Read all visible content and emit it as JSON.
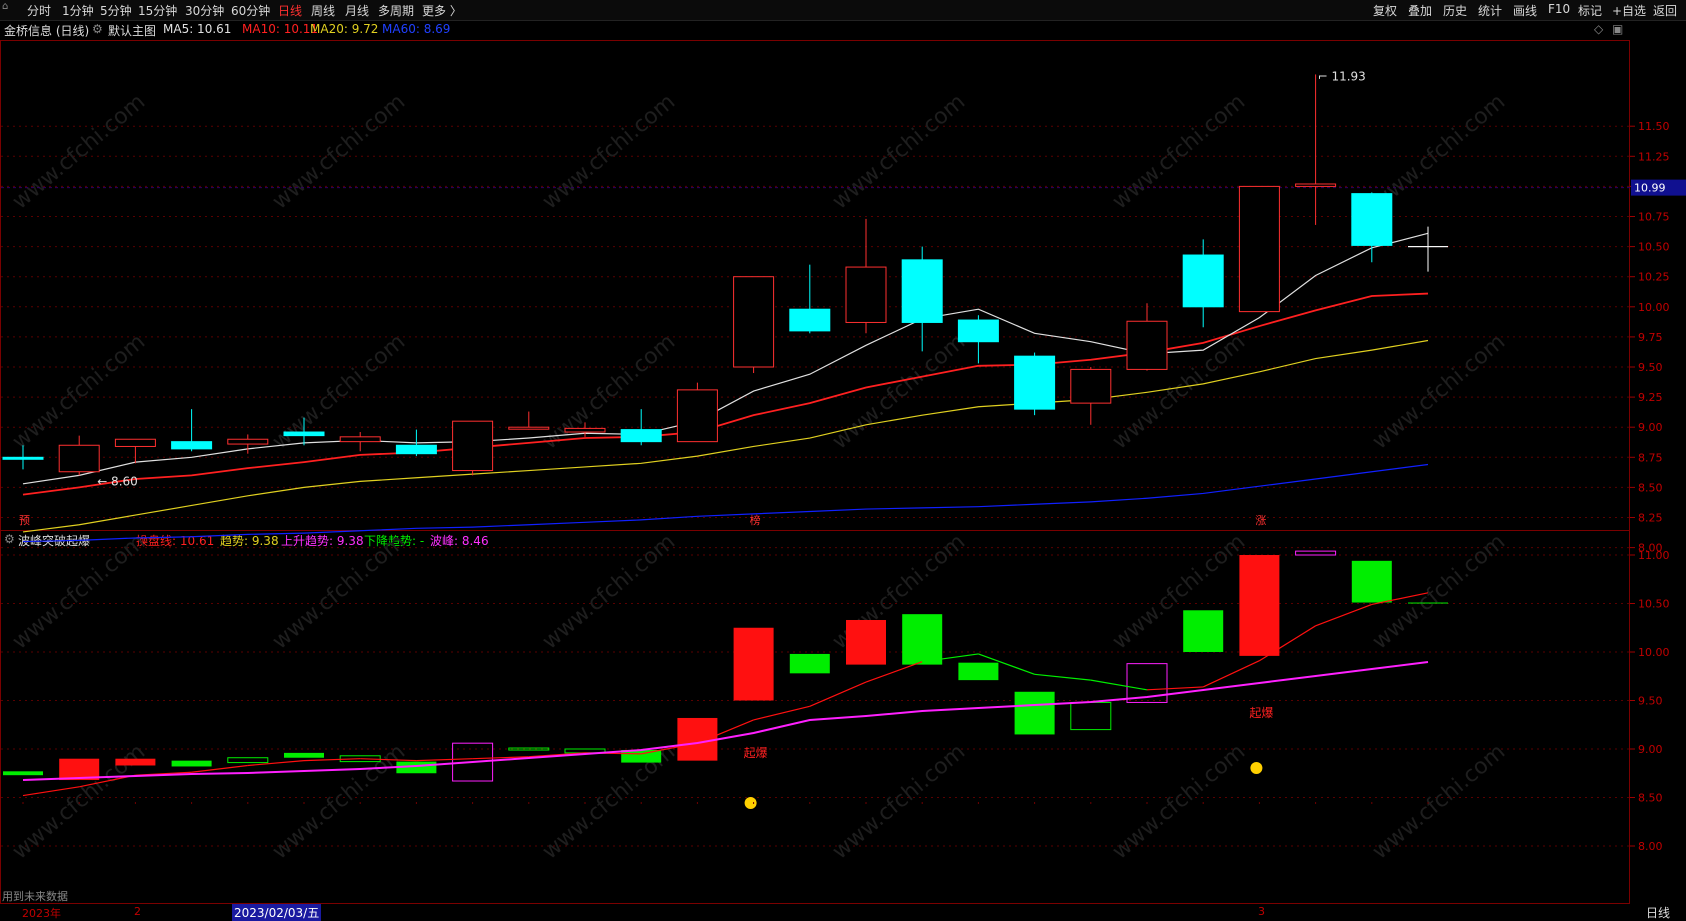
{
  "toolbar": {
    "periods": [
      "分时",
      "1分钟",
      "5分钟",
      "15分钟",
      "30分钟",
      "60分钟",
      "日线",
      "周线",
      "月线",
      "多周期",
      "更多 〉"
    ],
    "active_period": "日线",
    "right_buttons": [
      "复权",
      "叠加",
      "历史",
      "统计",
      "画线",
      "F10",
      "标记",
      "+自选",
      "返回"
    ]
  },
  "main_header": {
    "stock": "金桥信息 (日线)",
    "main_chart": "默认主图",
    "ma5": "MA5: 10.61",
    "ma10": "MA10: 10.11",
    "ma20": "MA20: 9.72",
    "ma60": "MA60: 8.69"
  },
  "sub_header": {
    "indicator": "波峰突破起爆",
    "cpx": "操盘线: 10.61",
    "trend": "趋势: 9.38",
    "up": "上升趋势: 9.38",
    "down": "下降趋势: -",
    "peak": "波峰: 8.46"
  },
  "main_axis": [
    "11.50",
    "11.25",
    "11.00",
    "10.75",
    "10.50",
    "10.25",
    "10.00",
    "9.75",
    "9.50",
    "9.25",
    "9.00",
    "8.75",
    "8.50",
    "8.25",
    "8.00"
  ],
  "current_price": "10.99",
  "high_label": "11.93",
  "low_label": "8.60",
  "sub_axis": [
    "11.00",
    "10.50",
    "10.00",
    "9.50",
    "9.00",
    "8.50",
    "8.00"
  ],
  "markers": {
    "yu": "预",
    "bang": "榜",
    "zhang": "涨",
    "qibao": "起爆"
  },
  "footer": {
    "future_data": "用到未来数据",
    "year": "2023年",
    "month2": "2",
    "date": "2023/02/03/五",
    "month3": "3",
    "period": "日线"
  },
  "watermark": "www.cfchi.com",
  "colors": {
    "up": "#ff3030",
    "down": "#00ffff",
    "ma5": "#e0e0e0",
    "ma10": "#ff2020",
    "ma20": "#e0d020",
    "ma60": "#1020ff",
    "sub_red": "#ff1010",
    "sub_green": "#00ee00",
    "sub_purple": "#ff20ff"
  },
  "chart_data": {
    "type": "candlestick",
    "candles": [
      {
        "o": 8.75,
        "h": 8.85,
        "l": 8.65,
        "c": 8.75,
        "dir": "down"
      },
      {
        "o": 8.63,
        "h": 8.93,
        "l": 8.6,
        "c": 8.85,
        "dir": "up"
      },
      {
        "o": 8.84,
        "h": 8.9,
        "l": 8.7,
        "c": 8.9,
        "dir": "up"
      },
      {
        "o": 8.88,
        "h": 9.15,
        "l": 8.8,
        "c": 8.82,
        "dir": "down"
      },
      {
        "o": 8.86,
        "h": 8.94,
        "l": 8.78,
        "c": 8.9,
        "dir": "up"
      },
      {
        "o": 8.96,
        "h": 9.08,
        "l": 8.85,
        "c": 8.93,
        "dir": "down"
      },
      {
        "o": 8.88,
        "h": 8.96,
        "l": 8.8,
        "c": 8.92,
        "dir": "up"
      },
      {
        "o": 8.85,
        "h": 8.98,
        "l": 8.76,
        "c": 8.78,
        "dir": "down"
      },
      {
        "o": 8.64,
        "h": 9.05,
        "l": 8.6,
        "c": 9.05,
        "dir": "up"
      },
      {
        "o": 9.0,
        "h": 9.13,
        "l": 8.98,
        "c": 9.0,
        "dir": "up"
      },
      {
        "o": 8.96,
        "h": 9.04,
        "l": 8.92,
        "c": 8.99,
        "dir": "up"
      },
      {
        "o": 8.98,
        "h": 9.15,
        "l": 8.85,
        "c": 8.88,
        "dir": "down"
      },
      {
        "o": 8.88,
        "h": 9.37,
        "l": 8.88,
        "c": 9.31,
        "dir": "up"
      },
      {
        "o": 9.5,
        "h": 10.25,
        "l": 9.45,
        "c": 10.25,
        "dir": "up"
      },
      {
        "o": 9.98,
        "h": 10.35,
        "l": 9.78,
        "c": 9.8,
        "dir": "down"
      },
      {
        "o": 9.87,
        "h": 10.73,
        "l": 9.78,
        "c": 10.33,
        "dir": "up"
      },
      {
        "o": 10.39,
        "h": 10.5,
        "l": 9.63,
        "c": 9.87,
        "dir": "down"
      },
      {
        "o": 9.89,
        "h": 9.93,
        "l": 9.53,
        "c": 9.71,
        "dir": "down"
      },
      {
        "o": 9.59,
        "h": 9.62,
        "l": 9.1,
        "c": 9.15,
        "dir": "down"
      },
      {
        "o": 9.2,
        "h": 9.5,
        "l": 9.02,
        "c": 9.48,
        "dir": "up"
      },
      {
        "o": 9.48,
        "h": 10.03,
        "l": 9.47,
        "c": 9.88,
        "dir": "up"
      },
      {
        "o": 10.43,
        "h": 10.56,
        "l": 9.83,
        "c": 10.0,
        "dir": "down"
      },
      {
        "o": 9.96,
        "h": 11.0,
        "l": 9.96,
        "c": 11.0,
        "dir": "up"
      },
      {
        "o": 11.0,
        "h": 11.93,
        "l": 10.68,
        "c": 11.02,
        "dir": "up"
      },
      {
        "o": 10.94,
        "h": 10.95,
        "l": 10.37,
        "c": 10.51,
        "dir": "down"
      },
      {
        "o": 10.5,
        "h": 10.66,
        "l": 10.3,
        "c": 10.5,
        "dir": "flat"
      }
    ],
    "ma5": [
      8.53,
      8.6,
      8.71,
      8.75,
      8.82,
      8.87,
      8.89,
      8.87,
      8.88,
      8.91,
      8.95,
      8.94,
      9.05,
      9.3,
      9.44,
      9.68,
      9.9,
      9.98,
      9.78,
      9.71,
      9.61,
      9.64,
      9.91,
      10.26,
      10.49,
      10.61
    ],
    "ma10": [
      8.44,
      8.5,
      8.57,
      8.6,
      8.66,
      8.71,
      8.77,
      8.79,
      8.83,
      8.87,
      8.91,
      8.92,
      8.96,
      9.1,
      9.2,
      9.33,
      9.42,
      9.51,
      9.52,
      9.56,
      9.62,
      9.7,
      9.84,
      9.97,
      10.09,
      10.11
    ],
    "ma20": [
      8.13,
      8.19,
      8.27,
      8.35,
      8.43,
      8.5,
      8.55,
      8.58,
      8.61,
      8.64,
      8.67,
      8.7,
      8.76,
      8.84,
      8.91,
      9.02,
      9.1,
      9.17,
      9.2,
      9.23,
      9.29,
      9.36,
      9.46,
      9.57,
      9.64,
      9.72
    ],
    "ma60": [
      8.05,
      8.06,
      8.08,
      8.09,
      8.11,
      8.12,
      8.14,
      8.16,
      8.17,
      8.19,
      8.21,
      8.23,
      8.26,
      8.28,
      8.3,
      8.32,
      8.33,
      8.34,
      8.36,
      8.38,
      8.41,
      8.45,
      8.51,
      8.57,
      8.63,
      8.69
    ]
  }
}
